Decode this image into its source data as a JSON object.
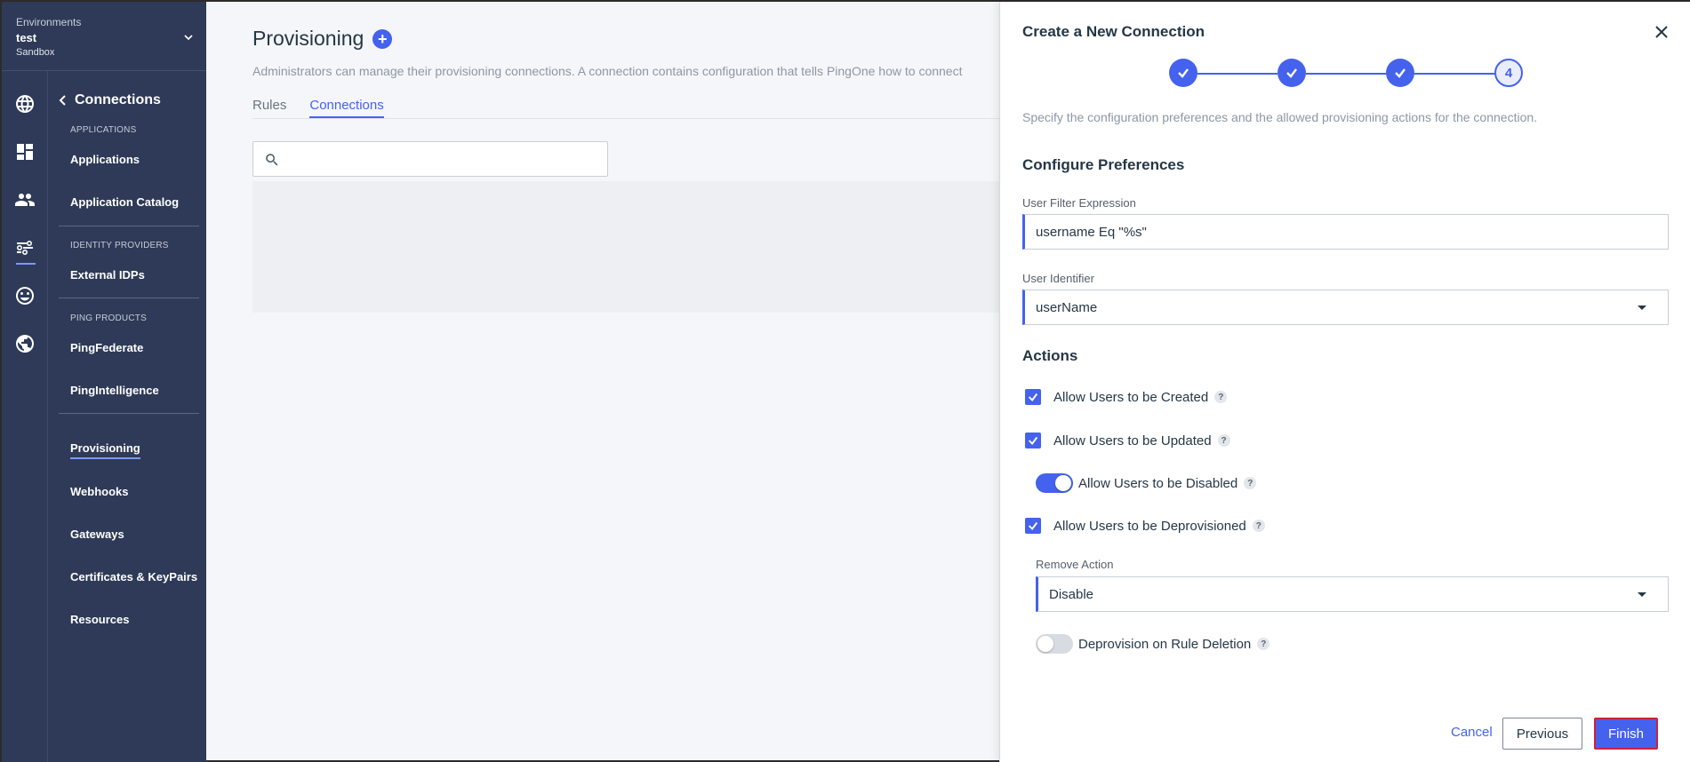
{
  "environment": {
    "label": "Environments",
    "name": "test",
    "type": "Sandbox"
  },
  "rail": {
    "icons": [
      "globe-icon",
      "dashboard-icon",
      "users-icon",
      "connections-icon",
      "experiences-icon",
      "world-icon"
    ]
  },
  "sidenav": {
    "back_label": "Connections",
    "sections": {
      "applications": "APPLICATIONS",
      "identity_providers": "IDENTITY PROVIDERS",
      "ping_products": "PING PRODUCTS"
    },
    "items": {
      "applications": "Applications",
      "application_catalog": "Application Catalog",
      "external_idps": "External IDPs",
      "pingfederate": "PingFederate",
      "pingintelligence": "PingIntelligence",
      "provisioning": "Provisioning",
      "webhooks": "Webhooks",
      "gateways": "Gateways",
      "certificates": "Certificates & KeyPairs",
      "resources": "Resources"
    }
  },
  "main": {
    "title": "Provisioning",
    "description": "Administrators can manage their provisioning connections. A connection contains configuration that tells PingOne how to connect",
    "tabs": {
      "rules": "Rules",
      "connections": "Connections"
    },
    "search": {
      "value": "",
      "placeholder": ""
    }
  },
  "panel": {
    "title": "Create a New Connection",
    "current_step": "4",
    "description": "Specify the configuration preferences and the allowed provisioning actions for the connection.",
    "configure_heading": "Configure Preferences",
    "user_filter": {
      "label": "User Filter Expression",
      "value": "username Eq \"%s\""
    },
    "user_identifier": {
      "label": "User Identifier",
      "value": "userName"
    },
    "actions_heading": "Actions",
    "actions": {
      "created": "Allow Users to be Created",
      "updated": "Allow Users to be Updated",
      "disabled": "Allow Users to be Disabled",
      "deprovisioned": "Allow Users to be Deprovisioned"
    },
    "remove_action": {
      "label": "Remove Action",
      "value": "Disable"
    },
    "deprovision_on_rule_deletion": "Deprovision on Rule Deletion",
    "help_glyph": "?",
    "buttons": {
      "cancel": "Cancel",
      "previous": "Previous",
      "finish": "Finish"
    }
  },
  "colors": {
    "accent": "#4462ed",
    "nav_bg": "#2e3a57",
    "finish_outline": "#c9233b"
  }
}
